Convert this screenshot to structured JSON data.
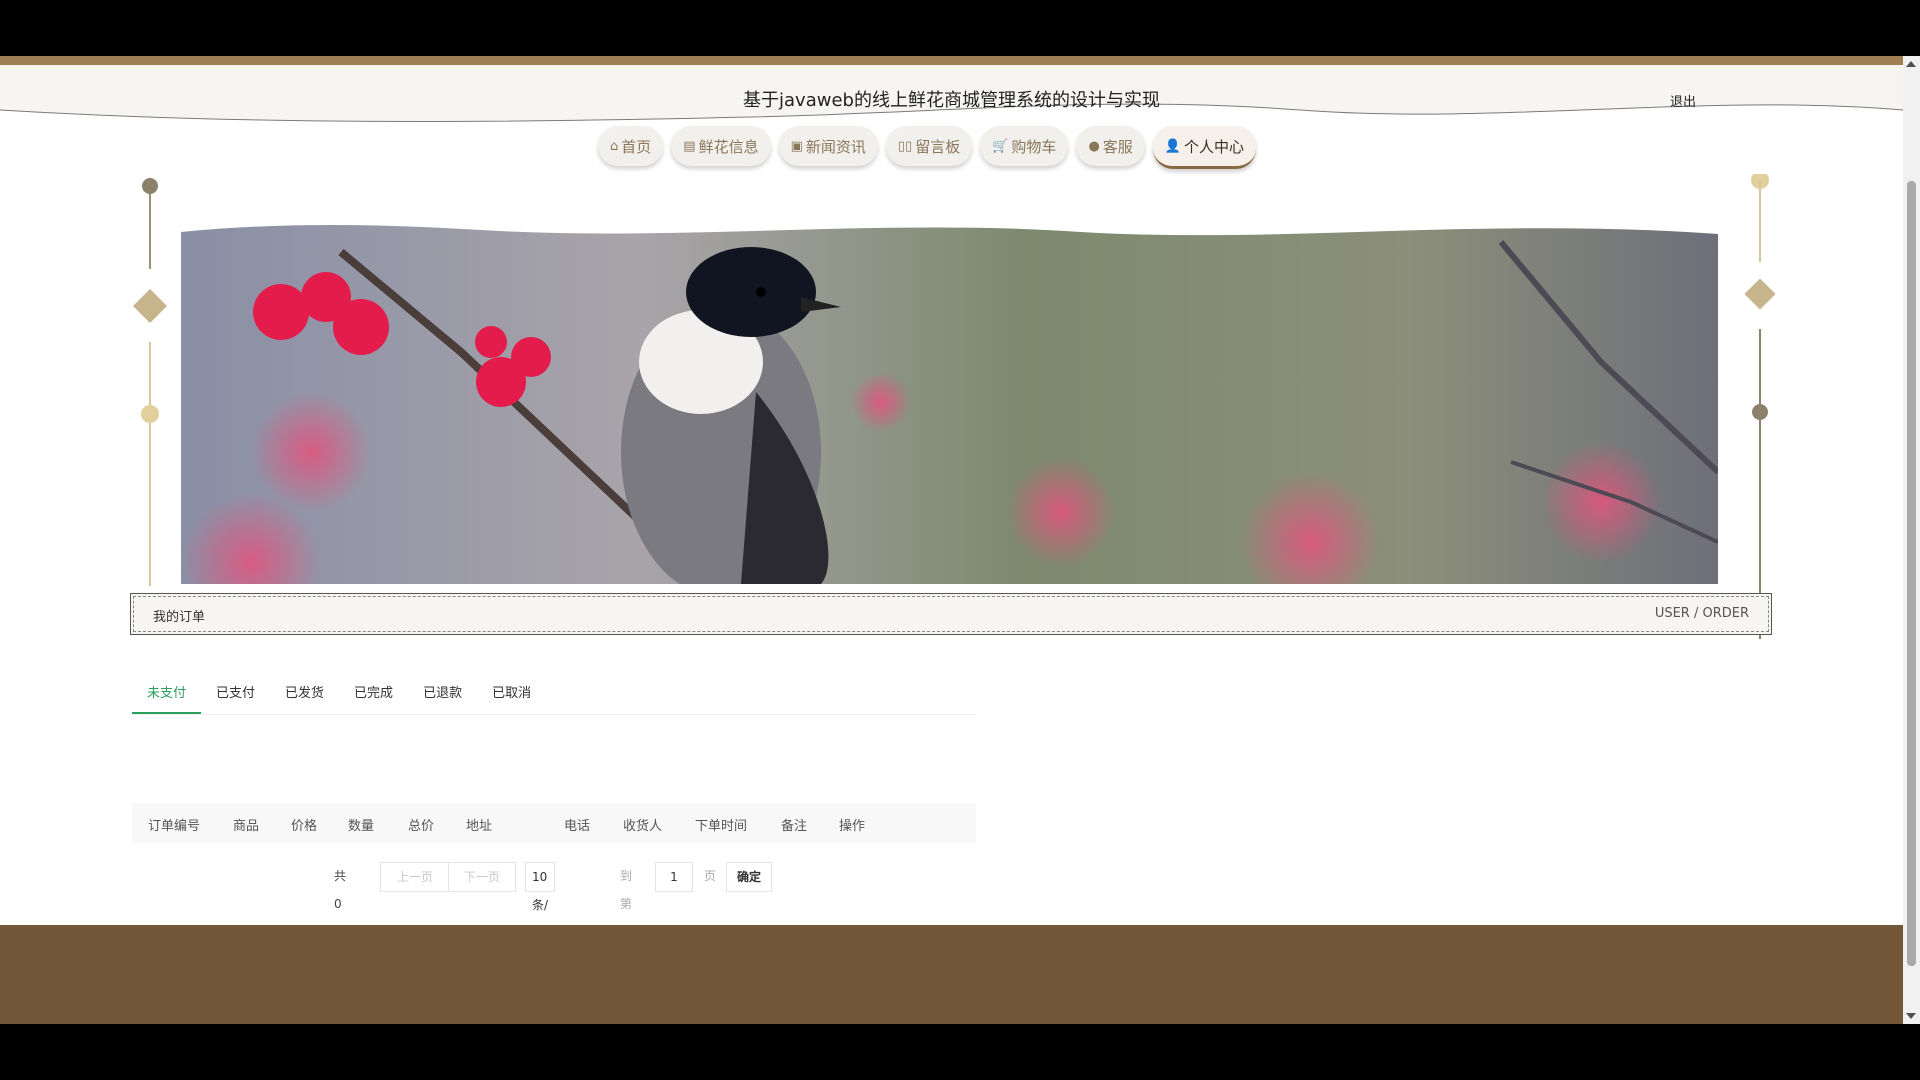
{
  "header": {
    "title": "基于javaweb的线上鲜花商城管理系统的设计与实现",
    "logout": "退出"
  },
  "nav": [
    {
      "icon": "⌂",
      "label": "首页"
    },
    {
      "icon": "▤",
      "label": "鲜花信息"
    },
    {
      "icon": "▣",
      "label": "新闻资讯"
    },
    {
      "icon": "▯▯",
      "label": "留言板"
    },
    {
      "icon": "🛒",
      "label": "购物车"
    },
    {
      "icon": "●",
      "label": "客服"
    },
    {
      "icon": "👤",
      "label": "个人中心"
    }
  ],
  "banner": {
    "slide_count": 3,
    "active_slide": 1
  },
  "section": {
    "title": "我的订单",
    "subtitle": "USER / ORDER"
  },
  "tabs": [
    "未支付",
    "已支付",
    "已发货",
    "已完成",
    "已退款",
    "已取消"
  ],
  "table": {
    "columns": [
      "订单编号",
      "商品",
      "价格",
      "数量",
      "总价",
      "地址",
      "电话",
      "收货人",
      "下单时间",
      "备注",
      "操作"
    ]
  },
  "pagination": {
    "total": "共 0 条",
    "prev": "上一页",
    "next": "下一页",
    "page_size": "10 条/页",
    "goto": "到第",
    "page_value": "1",
    "page_unit": "页",
    "confirm": "确定"
  },
  "colors": {
    "accent": "#8a6a44",
    "footer": "#715638",
    "tab_active": "#2aa05c"
  }
}
